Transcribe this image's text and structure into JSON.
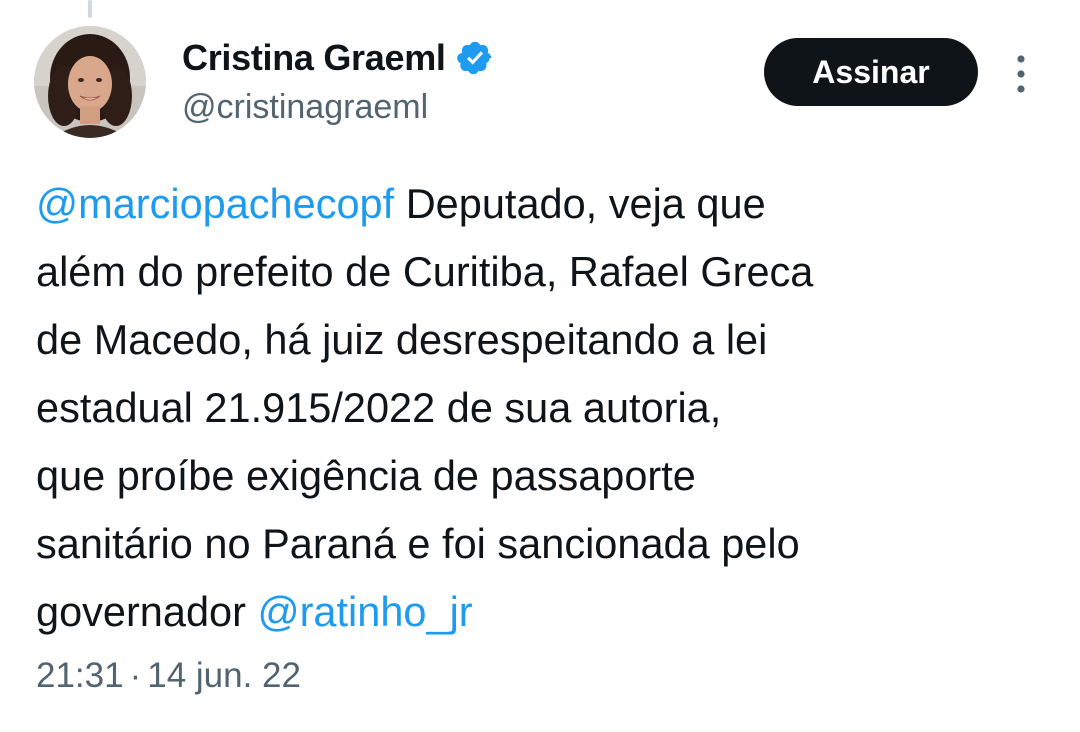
{
  "author": {
    "display_name": "Cristina Graeml",
    "handle": "@cristinagraeml",
    "verified_icon": "verified-badge-icon",
    "avatar_icon": "profile-photo"
  },
  "actions": {
    "subscribe_label": "Assinar",
    "more_icon": "more-vertical-icon"
  },
  "tweet": {
    "mention_1": "@marciopachecopf",
    "text_1": " Deputado, veja que\nalém do prefeito de Curitiba, Rafael Greca\nde Macedo, há juiz desrespeitando a lei\nestadual  21.915/2022 de sua autoria,\nque proíbe exigência de passaporte\nsanitário no Paraná e foi sancionada pelo\ngovernador ",
    "mention_2": "@ratinho_jr"
  },
  "meta": {
    "time": "21:31",
    "separator": "·",
    "date": "14 jun. 22"
  },
  "colors": {
    "link": "#1d9bf0",
    "text": "#0f1419",
    "secondary": "#536471",
    "button_bg": "#0f1419"
  }
}
